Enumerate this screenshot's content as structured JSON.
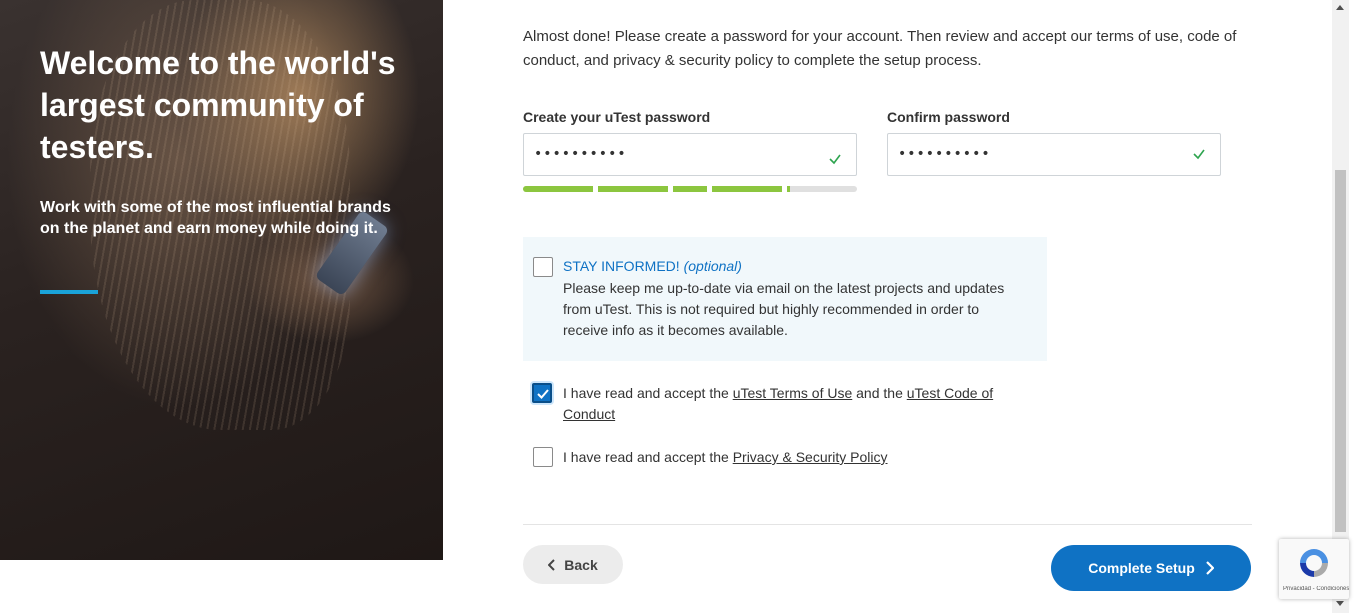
{
  "hero": {
    "title": "Welcome to the world's largest community of testers.",
    "subtitle": "Work with some of the most influential brands on the planet and earn money while doing it."
  },
  "intro": "Almost done! Please create a password for your account. Then review and accept our terms of use, code of conduct, and privacy & security policy to complete the setup process.",
  "password": {
    "label": "Create your uTest password",
    "value": "••••••••••",
    "valid": true
  },
  "confirm": {
    "label": "Confirm password",
    "value": "••••••••••",
    "valid": true
  },
  "strength": {
    "level": 0.8,
    "color": "#8cc63f"
  },
  "stay_informed": {
    "title": "STAY INFORMED!",
    "optional": "(optional)",
    "text": "Please keep me up-to-date via email on the latest projects and updates from uTest. This is not required but highly recommended in order to receive info as it becomes available.",
    "checked": false
  },
  "terms": {
    "prefix": "I have read and accept the ",
    "link1": "uTest Terms of Use",
    "middle": " and the ",
    "link2": "uTest Code of Conduct",
    "checked": true
  },
  "privacy": {
    "prefix": "I have read and accept the ",
    "link": "Privacy & Security Policy",
    "checked": false
  },
  "buttons": {
    "back": "Back",
    "complete": "Complete Setup"
  },
  "recaptcha": {
    "text": "Privacidad - Condiciones"
  },
  "colors": {
    "accent": "#0f72c4",
    "valid": "#2ea44f",
    "hero_accent": "#1aa3d9"
  }
}
